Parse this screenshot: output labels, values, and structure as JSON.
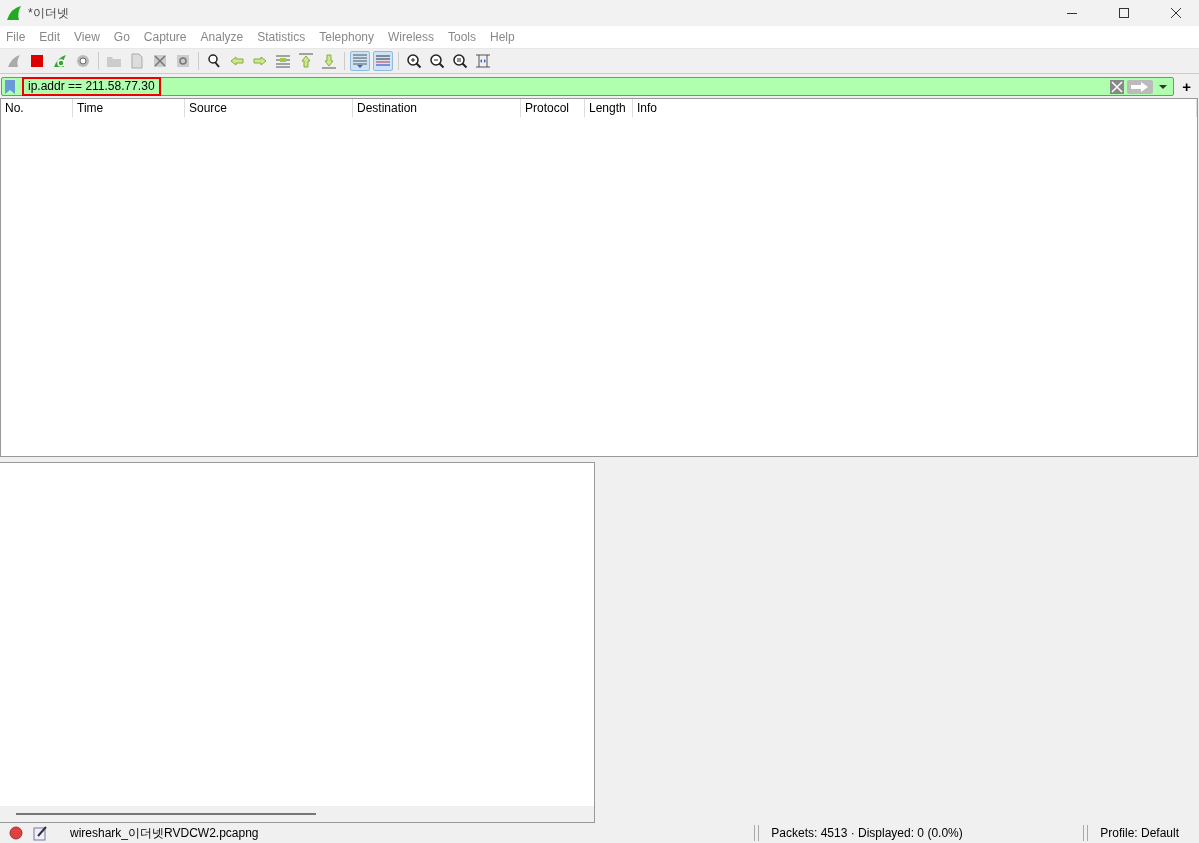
{
  "window": {
    "title": "*이더넷"
  },
  "menu": [
    "File",
    "Edit",
    "View",
    "Go",
    "Capture",
    "Analyze",
    "Statistics",
    "Telephony",
    "Wireless",
    "Tools",
    "Help"
  ],
  "toolbar": [
    {
      "pressed": false
    },
    {
      "pressed": false
    },
    {
      "pressed": false
    },
    {
      "pressed": false
    },
    {
      "pressed": false
    },
    {
      "pressed": false
    },
    {
      "pressed": false
    },
    {
      "pressed": false
    },
    {
      "pressed": false
    },
    {
      "pressed": false
    },
    {
      "pressed": false
    },
    {
      "pressed": false
    },
    {
      "pressed": false
    },
    {
      "pressed": false
    },
    {
      "pressed": true
    },
    {
      "pressed": true
    },
    {
      "pressed": false
    },
    {
      "pressed": false
    },
    {
      "pressed": false
    },
    {
      "pressed": false
    }
  ],
  "filter": {
    "value": "ip.addr == 211.58.77.30",
    "add_button": "+"
  },
  "packet_list": {
    "columns": [
      "No.",
      "Time",
      "Source",
      "Destination",
      "Protocol",
      "Length",
      "Info"
    ]
  },
  "status_bar": {
    "file": "wireshark_이더넷RVDCW2.pcapng",
    "packets": "Packets: 4513 · Displayed: 0 (0.0%)",
    "profile": "Profile: Default"
  }
}
